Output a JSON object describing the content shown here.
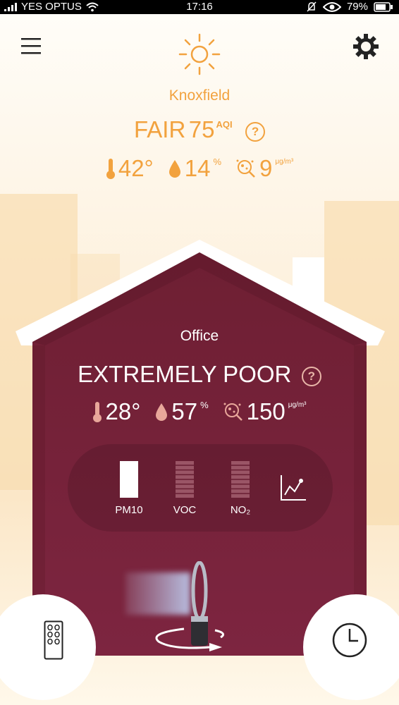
{
  "status": {
    "carrier": "YES OPTUS",
    "time": "17:16",
    "battery": "79%"
  },
  "header": {
    "menu_icon": "hamburger-menu-icon",
    "weather_icon": "sun-icon",
    "settings_icon": "gear-icon"
  },
  "outdoor": {
    "location": "Knoxfield",
    "quality": "FAIR",
    "aqi_value": "75",
    "aqi_unit": "AQI",
    "help": "?",
    "temperature": "42°",
    "humidity": "14",
    "humidity_unit": "%",
    "particulates": "9",
    "particulates_unit": "μg/m³"
  },
  "indoor": {
    "room": "Office",
    "quality": "EXTREMELY POOR",
    "help": "?",
    "temperature": "28°",
    "humidity": "57",
    "humidity_unit": "%",
    "particulates": "150",
    "particulates_unit": "μg/m³"
  },
  "pollutants": [
    {
      "label": "PM10",
      "level": 1.0
    },
    {
      "label": "VOC",
      "level": 0.0
    },
    {
      "label": "NO₂",
      "level": 0.0
    }
  ],
  "controls": {
    "graph_icon": "line-graph-icon",
    "remote_icon": "remote-control-icon",
    "schedule_icon": "clock-icon",
    "fan_icon": "purifier-fan-icon"
  },
  "colors": {
    "accent": "#f2a23e",
    "house": "#7a2238",
    "white": "#ffffff"
  }
}
